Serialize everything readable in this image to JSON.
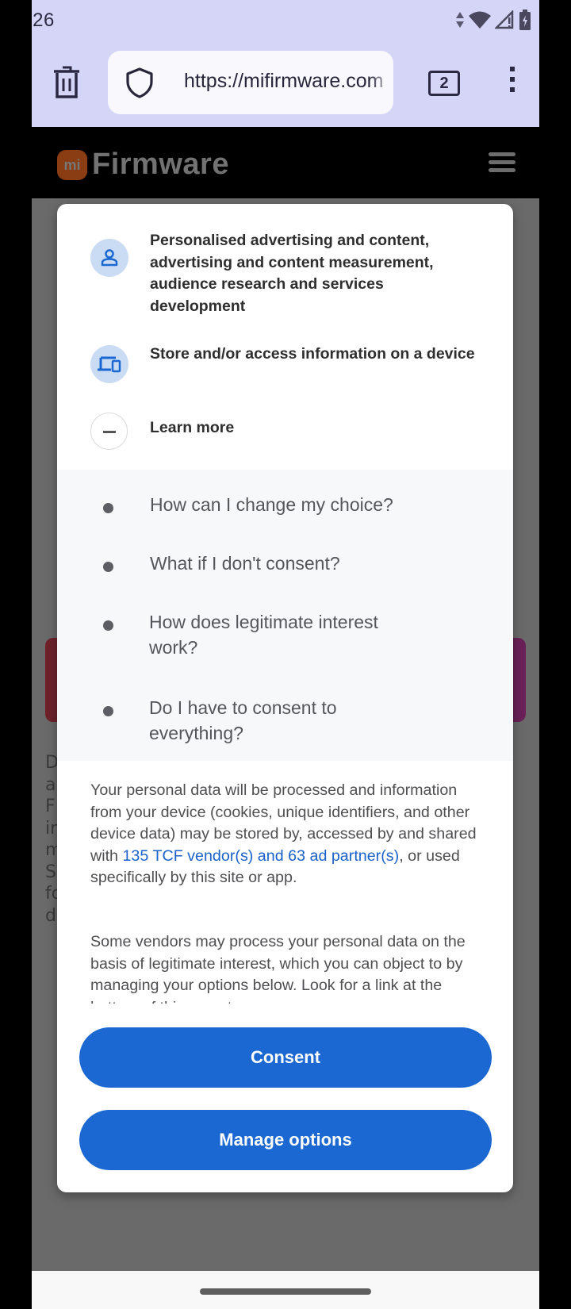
{
  "status_bar": {
    "time": ":26",
    "icons": [
      "data-arrows-icon",
      "wifi-icon",
      "signal-no-service-icon",
      "battery-charging-icon"
    ]
  },
  "browser": {
    "url": "https://mifirmware.com",
    "tab_count": "2",
    "icons": {
      "left_action": "trash-icon",
      "security": "shield-icon",
      "menu": "more-vert-icon"
    }
  },
  "site": {
    "logo_badge": "mi",
    "logo_text": "Firmware",
    "menu_icon": "hamburger-icon",
    "background_text_fragments": [
      "D",
      "a",
      "F",
      "in",
      "m",
      "S",
      "fo",
      "d"
    ]
  },
  "consent_dialog": {
    "purposes": [
      {
        "icon": "person-icon",
        "label": "Personalised advertising and content, advertising and content measurement, audience research and services development"
      },
      {
        "icon": "devices-icon",
        "label": "Store and/or access information on a device"
      }
    ],
    "learn_more": {
      "label": "Learn more",
      "state": "expanded",
      "icon": "minus-icon"
    },
    "faq": [
      "How can I change my choice?",
      "What if I don't consent?",
      "How does legitimate interest work?",
      "Do I have to consent to everything?"
    ],
    "paragraph1": {
      "before": "Your personal data will be processed and information from your device (cookies, unique identifiers, and other device data) may be stored by, accessed by and shared with ",
      "link": "135 TCF vendor(s) and 63 ad partner(s)",
      "after": ", or used specifically by this site or app."
    },
    "paragraph2": "Some vendors may process your personal data on the basis of legitimate interest, which you can object to by managing your options below. Look for a link at the bottom of this page to manage or",
    "buttons": {
      "consent": "Consent",
      "manage": "Manage options"
    },
    "colors": {
      "primary": "#1c68d3",
      "link": "#1a61c9",
      "icon_bg": "#c9dcf4"
    }
  }
}
